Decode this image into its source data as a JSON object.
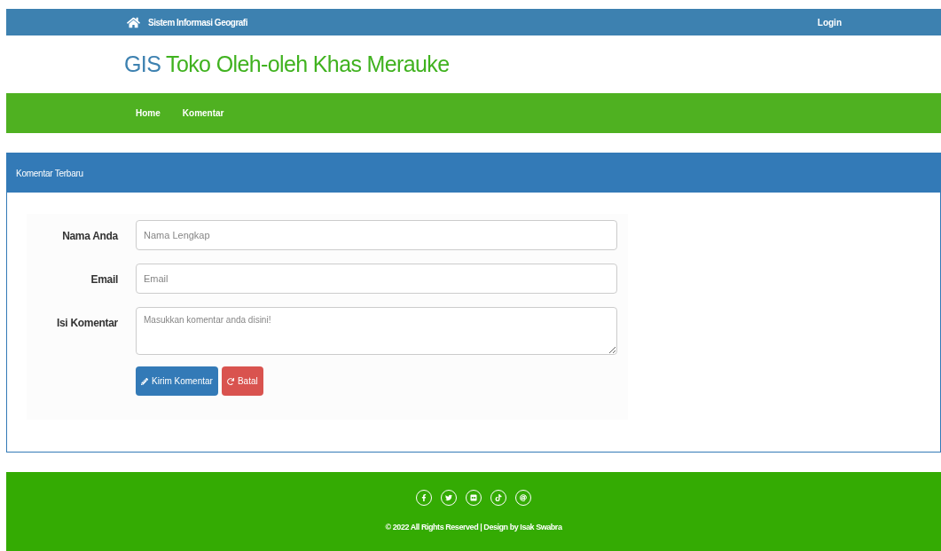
{
  "topbar": {
    "brand": "Sistem Informasi Geografi",
    "login": "Login"
  },
  "header": {
    "prefix": "GIS",
    "title": "Toko Oleh-oleh Khas Merauke"
  },
  "nav": [
    {
      "label": "Home"
    },
    {
      "label": "Komentar"
    }
  ],
  "panel": {
    "title": "Komentar Terbaru",
    "fields": [
      {
        "kind": "input",
        "label": "Nama Anda",
        "placeholder": "Nama Lengkap"
      },
      {
        "kind": "input",
        "label": "Email",
        "placeholder": "Email"
      },
      {
        "kind": "textarea",
        "label": "Isi Komentar",
        "placeholder": "Masukkan komentar anda disini!"
      }
    ],
    "buttons": [
      {
        "kind": "primary",
        "label": "Kirim Komentar"
      },
      {
        "kind": "danger",
        "label": "Batal"
      }
    ]
  },
  "footer": {
    "icons": [
      {
        "kind": "f"
      },
      {
        "kind": "bird"
      },
      {
        "kind": "dots"
      },
      {
        "kind": "note"
      },
      {
        "kind": "at"
      }
    ],
    "copyright": "© 2022  All Rights Reserved | Design by Isak Swabra"
  }
}
